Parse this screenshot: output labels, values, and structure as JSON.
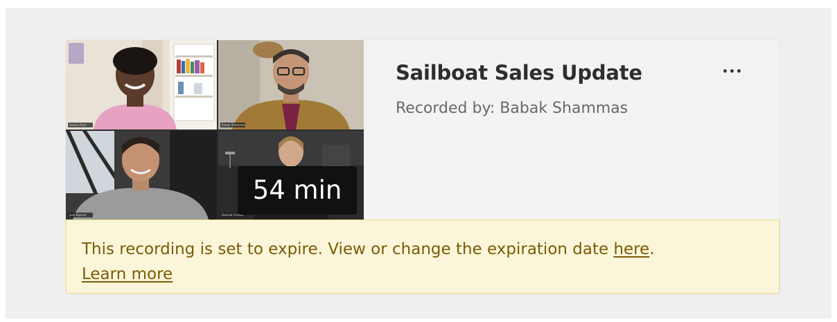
{
  "recording": {
    "title": "Sailboat Sales Update",
    "recorded_by": "Recorded by: Babak Shammas",
    "duration": "54 min",
    "more_icon": "more-horizontal-icon"
  },
  "thumbnail": {
    "participants": [
      {
        "tag": "Serena Ross"
      },
      {
        "tag": "Babak Shammas"
      },
      {
        "tag": "Josh Kaymer"
      },
      {
        "tag": "Daniela Carlson"
      }
    ]
  },
  "banner": {
    "text": "This recording is set to expire. View or change the expiration date ",
    "here_link": "here",
    "period": ".",
    "learn_more": "Learn more"
  },
  "colors": {
    "banner_bg": "#fbf6d9",
    "banner_text": "#7a5a07",
    "card_bg": "#f4f3f2"
  }
}
